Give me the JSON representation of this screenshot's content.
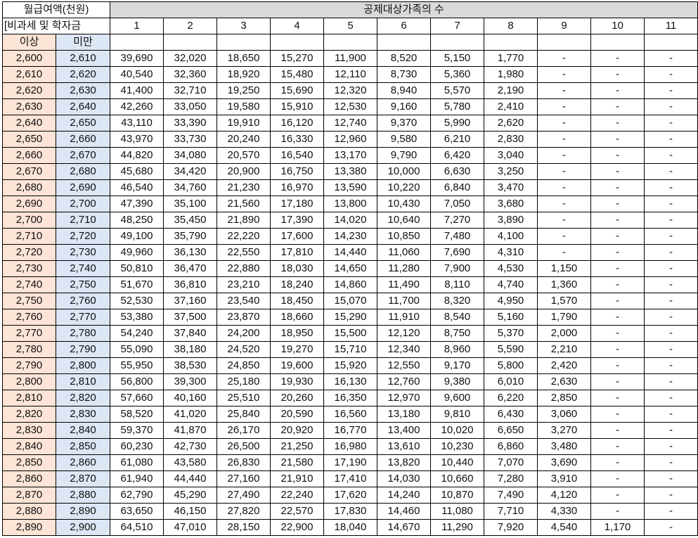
{
  "header": {
    "salary_label_line1": "월급여액(천원)",
    "salary_label_line2": "[비과세 및 학자금",
    "dependents_label": "공제대상가족의 수",
    "dependents_columns": [
      "1",
      "2",
      "3",
      "4",
      "5",
      "6",
      "7",
      "8",
      "9",
      "10",
      "11"
    ],
    "lower_label": "이상",
    "upper_label": "미만"
  },
  "colors": {
    "lower_bound_bg": "#fce4d6",
    "upper_bound_bg": "#dde6f5",
    "header_bg": "#d9d9d9"
  },
  "rows": [
    {
      "lo": "2,600",
      "hi": "2,610",
      "v": [
        "39,690",
        "32,020",
        "18,650",
        "15,270",
        "11,900",
        "8,520",
        "5,150",
        "1,770",
        "-",
        "-",
        "-"
      ]
    },
    {
      "lo": "2,610",
      "hi": "2,620",
      "v": [
        "40,540",
        "32,360",
        "18,920",
        "15,480",
        "12,110",
        "8,730",
        "5,360",
        "1,980",
        "-",
        "-",
        "-"
      ]
    },
    {
      "lo": "2,620",
      "hi": "2,630",
      "v": [
        "41,400",
        "32,710",
        "19,250",
        "15,690",
        "12,320",
        "8,940",
        "5,570",
        "2,190",
        "-",
        "-",
        "-"
      ]
    },
    {
      "lo": "2,630",
      "hi": "2,640",
      "v": [
        "42,260",
        "33,050",
        "19,580",
        "15,910",
        "12,530",
        "9,160",
        "5,780",
        "2,410",
        "-",
        "-",
        "-"
      ]
    },
    {
      "lo": "2,640",
      "hi": "2,650",
      "v": [
        "43,110",
        "33,390",
        "19,910",
        "16,120",
        "12,740",
        "9,370",
        "5,990",
        "2,620",
        "-",
        "-",
        "-"
      ]
    },
    {
      "lo": "2,650",
      "hi": "2,660",
      "v": [
        "43,970",
        "33,730",
        "20,240",
        "16,330",
        "12,960",
        "9,580",
        "6,210",
        "2,830",
        "-",
        "-",
        "-"
      ]
    },
    {
      "lo": "2,660",
      "hi": "2,670",
      "v": [
        "44,820",
        "34,080",
        "20,570",
        "16,540",
        "13,170",
        "9,790",
        "6,420",
        "3,040",
        "-",
        "-",
        "-"
      ]
    },
    {
      "lo": "2,670",
      "hi": "2,680",
      "v": [
        "45,680",
        "34,420",
        "20,900",
        "16,750",
        "13,380",
        "10,000",
        "6,630",
        "3,250",
        "-",
        "-",
        "-"
      ]
    },
    {
      "lo": "2,680",
      "hi": "2,690",
      "v": [
        "46,540",
        "34,760",
        "21,230",
        "16,970",
        "13,590",
        "10,220",
        "6,840",
        "3,470",
        "-",
        "-",
        "-"
      ]
    },
    {
      "lo": "2,690",
      "hi": "2,700",
      "v": [
        "47,390",
        "35,100",
        "21,560",
        "17,180",
        "13,800",
        "10,430",
        "7,050",
        "3,680",
        "-",
        "-",
        "-"
      ]
    },
    {
      "lo": "2,700",
      "hi": "2,710",
      "v": [
        "48,250",
        "35,450",
        "21,890",
        "17,390",
        "14,020",
        "10,640",
        "7,270",
        "3,890",
        "-",
        "-",
        "-"
      ]
    },
    {
      "lo": "2,710",
      "hi": "2,720",
      "v": [
        "49,100",
        "35,790",
        "22,220",
        "17,600",
        "14,230",
        "10,850",
        "7,480",
        "4,100",
        "-",
        "-",
        "-"
      ]
    },
    {
      "lo": "2,720",
      "hi": "2,730",
      "v": [
        "49,960",
        "36,130",
        "22,550",
        "17,810",
        "14,440",
        "11,060",
        "7,690",
        "4,310",
        "-",
        "-",
        "-"
      ]
    },
    {
      "lo": "2,730",
      "hi": "2,740",
      "v": [
        "50,810",
        "36,470",
        "22,880",
        "18,030",
        "14,650",
        "11,280",
        "7,900",
        "4,530",
        "1,150",
        "-",
        "-"
      ]
    },
    {
      "lo": "2,740",
      "hi": "2,750",
      "v": [
        "51,670",
        "36,810",
        "23,210",
        "18,240",
        "14,860",
        "11,490",
        "8,110",
        "4,740",
        "1,360",
        "-",
        "-"
      ]
    },
    {
      "lo": "2,750",
      "hi": "2,760",
      "v": [
        "52,530",
        "37,160",
        "23,540",
        "18,450",
        "15,070",
        "11,700",
        "8,320",
        "4,950",
        "1,570",
        "-",
        "-"
      ]
    },
    {
      "lo": "2,760",
      "hi": "2,770",
      "v": [
        "53,380",
        "37,500",
        "23,870",
        "18,660",
        "15,290",
        "11,910",
        "8,540",
        "5,160",
        "1,790",
        "-",
        "-"
      ]
    },
    {
      "lo": "2,770",
      "hi": "2,780",
      "v": [
        "54,240",
        "37,840",
        "24,200",
        "18,950",
        "15,500",
        "12,120",
        "8,750",
        "5,370",
        "2,000",
        "-",
        "-"
      ]
    },
    {
      "lo": "2,780",
      "hi": "2,790",
      "v": [
        "55,090",
        "38,180",
        "24,520",
        "19,270",
        "15,710",
        "12,340",
        "8,960",
        "5,590",
        "2,210",
        "-",
        "-"
      ]
    },
    {
      "lo": "2,790",
      "hi": "2,800",
      "v": [
        "55,950",
        "38,530",
        "24,850",
        "19,600",
        "15,920",
        "12,550",
        "9,170",
        "5,800",
        "2,420",
        "-",
        "-"
      ]
    },
    {
      "lo": "2,800",
      "hi": "2,810",
      "v": [
        "56,800",
        "39,300",
        "25,180",
        "19,930",
        "16,130",
        "12,760",
        "9,380",
        "6,010",
        "2,630",
        "-",
        "-"
      ]
    },
    {
      "lo": "2,810",
      "hi": "2,820",
      "v": [
        "57,660",
        "40,160",
        "25,510",
        "20,260",
        "16,350",
        "12,970",
        "9,600",
        "6,220",
        "2,850",
        "-",
        "-"
      ]
    },
    {
      "lo": "2,820",
      "hi": "2,830",
      "v": [
        "58,520",
        "41,020",
        "25,840",
        "20,590",
        "16,560",
        "13,180",
        "9,810",
        "6,430",
        "3,060",
        "-",
        "-"
      ]
    },
    {
      "lo": "2,830",
      "hi": "2,840",
      "v": [
        "59,370",
        "41,870",
        "26,170",
        "20,920",
        "16,770",
        "13,400",
        "10,020",
        "6,650",
        "3,270",
        "-",
        "-"
      ]
    },
    {
      "lo": "2,840",
      "hi": "2,850",
      "v": [
        "60,230",
        "42,730",
        "26,500",
        "21,250",
        "16,980",
        "13,610",
        "10,230",
        "6,860",
        "3,480",
        "-",
        "-"
      ]
    },
    {
      "lo": "2,850",
      "hi": "2,860",
      "v": [
        "61,080",
        "43,580",
        "26,830",
        "21,580",
        "17,190",
        "13,820",
        "10,440",
        "7,070",
        "3,690",
        "-",
        "-"
      ]
    },
    {
      "lo": "2,860",
      "hi": "2,870",
      "v": [
        "61,940",
        "44,440",
        "27,160",
        "21,910",
        "17,410",
        "14,030",
        "10,660",
        "7,280",
        "3,910",
        "-",
        "-"
      ]
    },
    {
      "lo": "2,870",
      "hi": "2,880",
      "v": [
        "62,790",
        "45,290",
        "27,490",
        "22,240",
        "17,620",
        "14,240",
        "10,870",
        "7,490",
        "4,120",
        "-",
        "-"
      ]
    },
    {
      "lo": "2,880",
      "hi": "2,890",
      "v": [
        "63,650",
        "46,150",
        "27,820",
        "22,570",
        "17,830",
        "14,460",
        "11,080",
        "7,710",
        "4,330",
        "-",
        "-"
      ]
    },
    {
      "lo": "2,890",
      "hi": "2,900",
      "v": [
        "64,510",
        "47,010",
        "28,150",
        "22,900",
        "18,040",
        "14,670",
        "11,290",
        "7,920",
        "4,540",
        "1,170",
        "-"
      ]
    }
  ]
}
